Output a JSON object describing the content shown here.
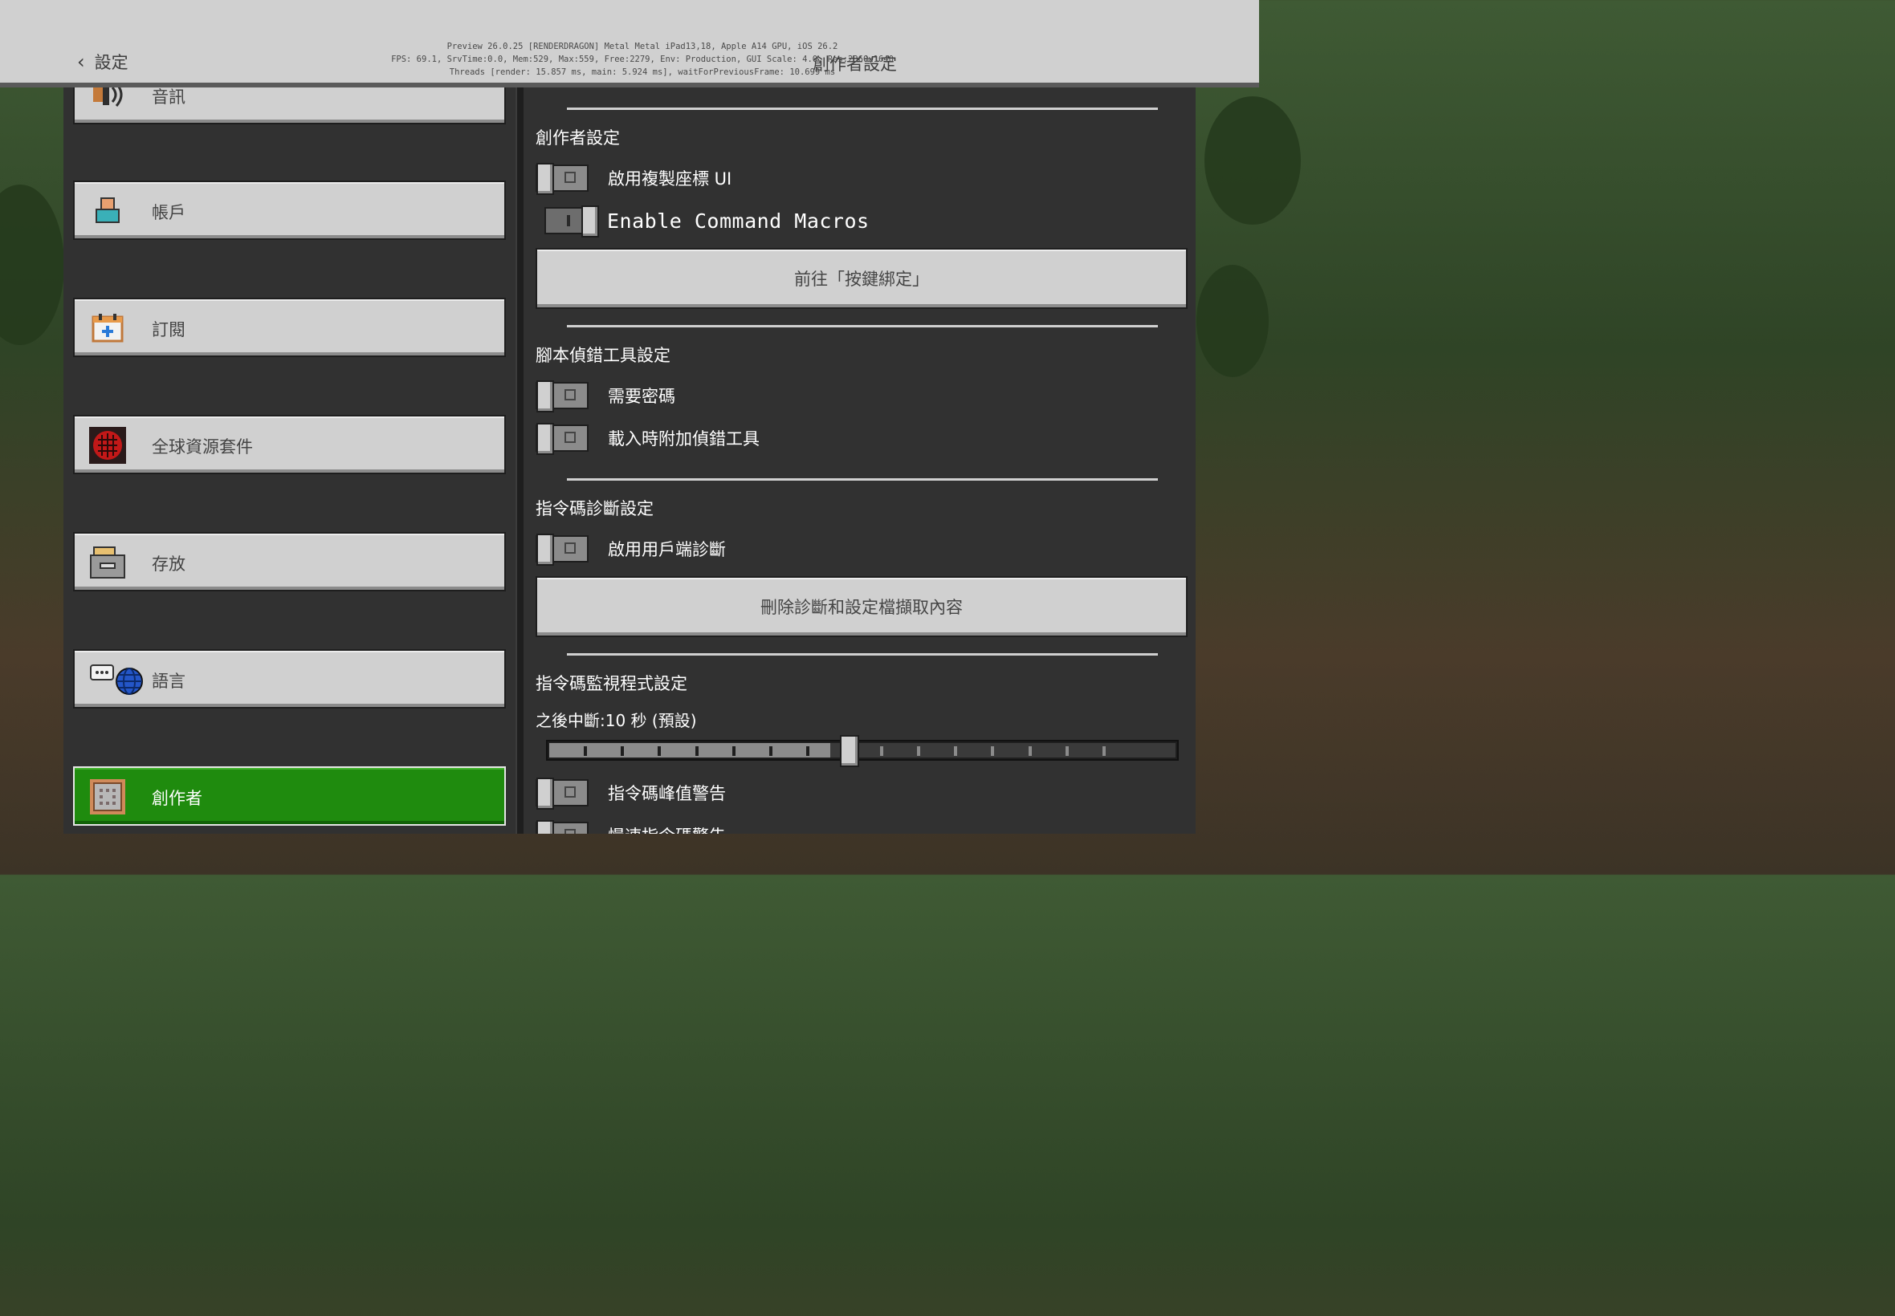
{
  "header": {
    "back_label": "設定",
    "title": "創作者設定",
    "debug_lines": [
      "Preview 26.0.25 [RENDERDRAGON] Metal Metal iPad13,18, Apple A14 GPU, iOS 26.2",
      "FPS: 69.1, SrvTime:0.0, Mem:529, Max:559, Free:2279, Env: Production, GUI Scale: 4.0, Res:2360x1640",
      "Threads [render: 15.857 ms, main: 5.924 ms], waitForPreviousFrame: 10.699 ms"
    ]
  },
  "sidebar": {
    "items": [
      {
        "label": "音訊",
        "icon": "speaker-icon",
        "active": false
      },
      {
        "label": "帳戶",
        "icon": "account-icon",
        "active": false
      },
      {
        "label": "訂閱",
        "icon": "subscription-icon",
        "active": false
      },
      {
        "label": "全球資源套件",
        "icon": "resource-pack-icon",
        "active": false
      },
      {
        "label": "存放",
        "icon": "storage-icon",
        "active": false
      },
      {
        "label": "語言",
        "icon": "language-icon",
        "active": false
      },
      {
        "label": "創作者",
        "icon": "command-block-icon",
        "active": true
      }
    ]
  },
  "content": {
    "creator_section": {
      "title": "創作者設定",
      "toggles": [
        {
          "label": "啟用複製座標 UI",
          "on": false
        },
        {
          "label": "Enable Command Macros",
          "on": true
        }
      ],
      "button": "前往「按鍵綁定」"
    },
    "script_debug_section": {
      "title": "腳本偵錯工具設定",
      "toggles": [
        {
          "label": "需要密碼",
          "on": false
        },
        {
          "label": "載入時附加偵錯工具",
          "on": false
        }
      ]
    },
    "diagnostics_section": {
      "title": "指令碼診斷設定",
      "toggles": [
        {
          "label": "啟用用戶端診斷",
          "on": false
        }
      ],
      "button": "刪除診斷和設定檔擷取內容"
    },
    "watchdog_section": {
      "title": "指令碼監視程式設定",
      "slider_label": "之後中斷:10 秒 (預設)",
      "slider_steps": 17,
      "slider_value_index": 7,
      "toggles": [
        {
          "label": "指令碼峰值警告",
          "on": false
        },
        {
          "label": "慢速指令碼警告",
          "on": false
        }
      ]
    }
  },
  "colors": {
    "panel": "#313131",
    "button": "#d0d0d0",
    "active": "#1f8b0e",
    "header": "#d0d0d0"
  }
}
